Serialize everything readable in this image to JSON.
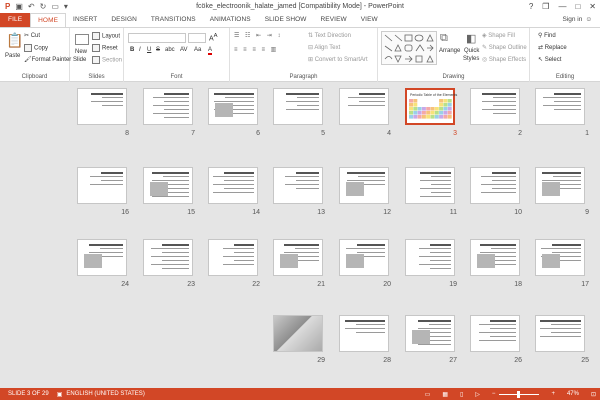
{
  "app": {
    "title": "fcöke_electroonik_halate_jamed [Compatibility Mode] - PowerPoint",
    "sign_in": "Sign in"
  },
  "qat": [
    "save-icon",
    "undo-icon",
    "redo-icon",
    "present-icon",
    "customize-icon"
  ],
  "window_buttons": {
    "help": "?",
    "restore": "❐",
    "minimize": "—",
    "maximize": "□",
    "close": "✕"
  },
  "tabs": [
    "FILE",
    "HOME",
    "INSERT",
    "DESIGN",
    "TRANSITIONS",
    "ANIMATIONS",
    "SLIDE SHOW",
    "REVIEW",
    "VIEW"
  ],
  "active_tab": "HOME",
  "ribbon": {
    "clipboard": {
      "label": "Clipboard",
      "paste": "Paste",
      "cut": "Cut",
      "copy": "Copy",
      "format_painter": "Format Painter"
    },
    "slides": {
      "label": "Slides",
      "new_slide": "New",
      "new_slide2": "Slide",
      "layout": "Layout",
      "reset": "Reset",
      "section": "Section"
    },
    "font": {
      "label": "Font",
      "bold": "B",
      "italic": "I",
      "underline": "U",
      "strike": "S",
      "shadow": "abc",
      "spacing": "AV",
      "case": "Aa",
      "color": "A"
    },
    "paragraph": {
      "label": "Paragraph",
      "text_direction": "Text Direction",
      "align_text": "Align Text",
      "convert_smartart": "Convert to SmartArt"
    },
    "drawing": {
      "label": "Drawing",
      "arrange": "Arrange",
      "quick_styles": "Quick",
      "quick_styles2": "Styles",
      "shape_fill": "Shape Fill",
      "shape_outline": "Shape Outline",
      "shape_effects": "Shape Effects"
    },
    "editing": {
      "label": "Editing",
      "find": "Find",
      "replace": "Replace",
      "select": "Select"
    }
  },
  "slides": [
    {
      "num": "1"
    },
    {
      "num": "2"
    },
    {
      "num": "3"
    },
    {
      "num": "4"
    },
    {
      "num": "5"
    },
    {
      "num": "6"
    },
    {
      "num": "7"
    },
    {
      "num": "8"
    },
    {
      "num": "9"
    },
    {
      "num": "10"
    },
    {
      "num": "11"
    },
    {
      "num": "12"
    },
    {
      "num": "13"
    },
    {
      "num": "14"
    },
    {
      "num": "15"
    },
    {
      "num": "16"
    },
    {
      "num": "17"
    },
    {
      "num": "18"
    },
    {
      "num": "19"
    },
    {
      "num": "20"
    },
    {
      "num": "21"
    },
    {
      "num": "22"
    },
    {
      "num": "23"
    },
    {
      "num": "24"
    },
    {
      "num": "25"
    },
    {
      "num": "26"
    },
    {
      "num": "27"
    },
    {
      "num": "28"
    },
    {
      "num": "29"
    }
  ],
  "selected_slide": "3",
  "slide3_title": "Periodic Table of the Elements",
  "status": {
    "slide_info": "SLIDE 3 OF 29",
    "language": "ENGLISH (UNITED STATES)",
    "zoom": "47%",
    "zoom_level": 0.47
  },
  "colors": {
    "accent": "#d24726",
    "workarea": "#e5e5e5"
  }
}
